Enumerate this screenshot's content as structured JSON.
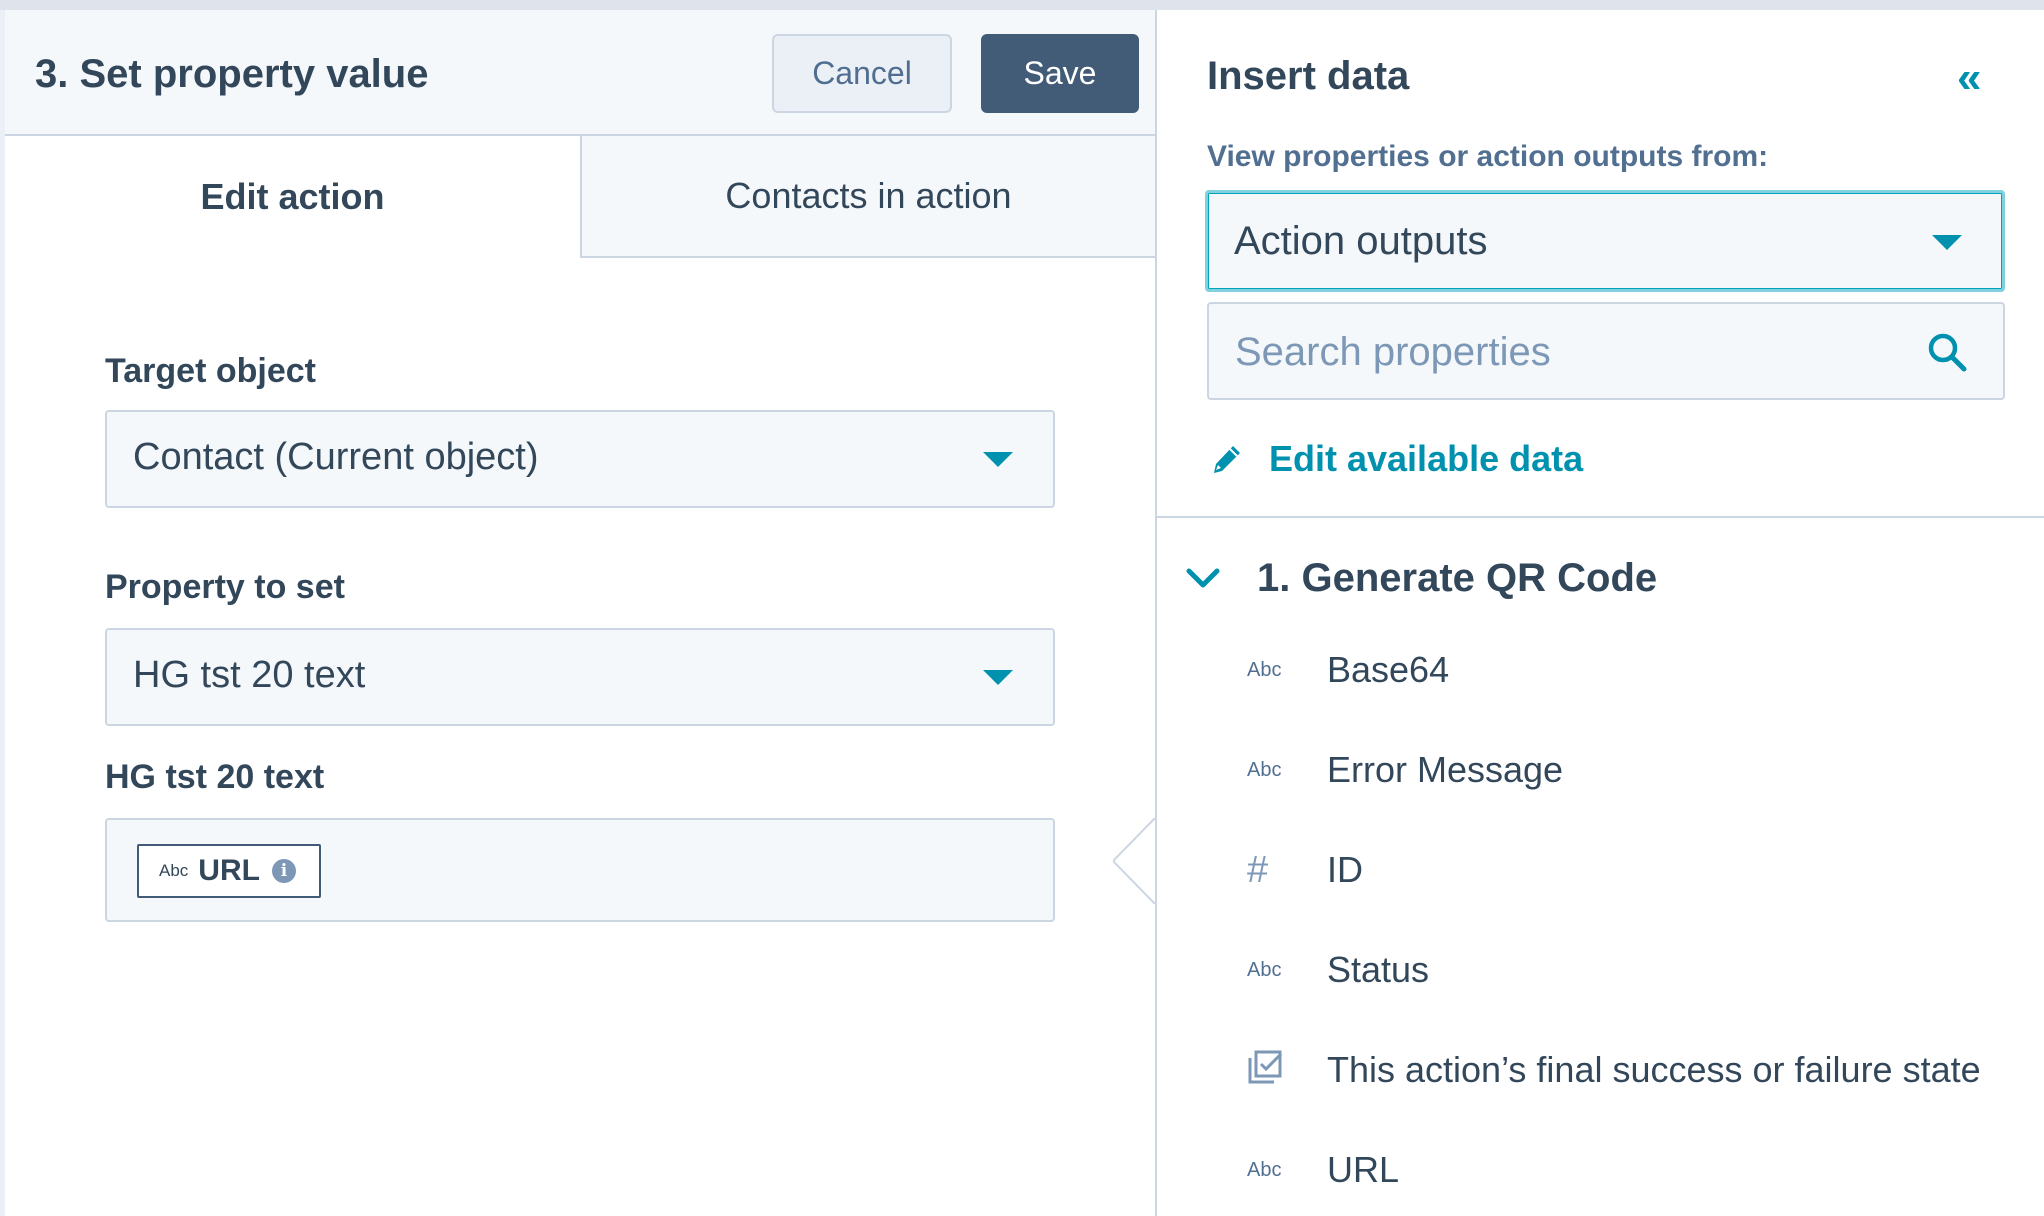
{
  "header": {
    "title": "3. Set property value",
    "cancel_label": "Cancel",
    "save_label": "Save"
  },
  "tabs": [
    {
      "label": "Edit action",
      "active": true
    },
    {
      "label": "Contacts in action",
      "active": false
    }
  ],
  "form": {
    "target_object": {
      "label": "Target object",
      "value": "Contact (Current object)"
    },
    "property_to_set": {
      "label": "Property to set",
      "value": "HG tst 20 text"
    },
    "value_field": {
      "label": "HG tst 20 text",
      "token": {
        "type": "Abc",
        "label": "URL",
        "info": "i"
      }
    }
  },
  "insert_panel": {
    "title": "Insert data",
    "collapse_icon": "double-chevron-left-icon",
    "view_label": "View properties or action outputs from:",
    "source_value": "Action outputs",
    "search_placeholder": "Search properties",
    "edit_data_label": "Edit available data",
    "group": {
      "title": "1. Generate QR Code",
      "items": [
        {
          "type": "Abc",
          "label": "Base64"
        },
        {
          "type": "Abc",
          "label": "Error Message"
        },
        {
          "type": "#",
          "label": "ID"
        },
        {
          "type": "Abc",
          "label": "Status"
        },
        {
          "type": "state-icon",
          "label": "This action’s final success or failure state"
        },
        {
          "type": "Abc",
          "label": "URL"
        }
      ]
    }
  },
  "colors": {
    "accent": "#0091ae",
    "primary_button": "#425b76",
    "text": "#33475b",
    "border": "#cbd6e2"
  }
}
